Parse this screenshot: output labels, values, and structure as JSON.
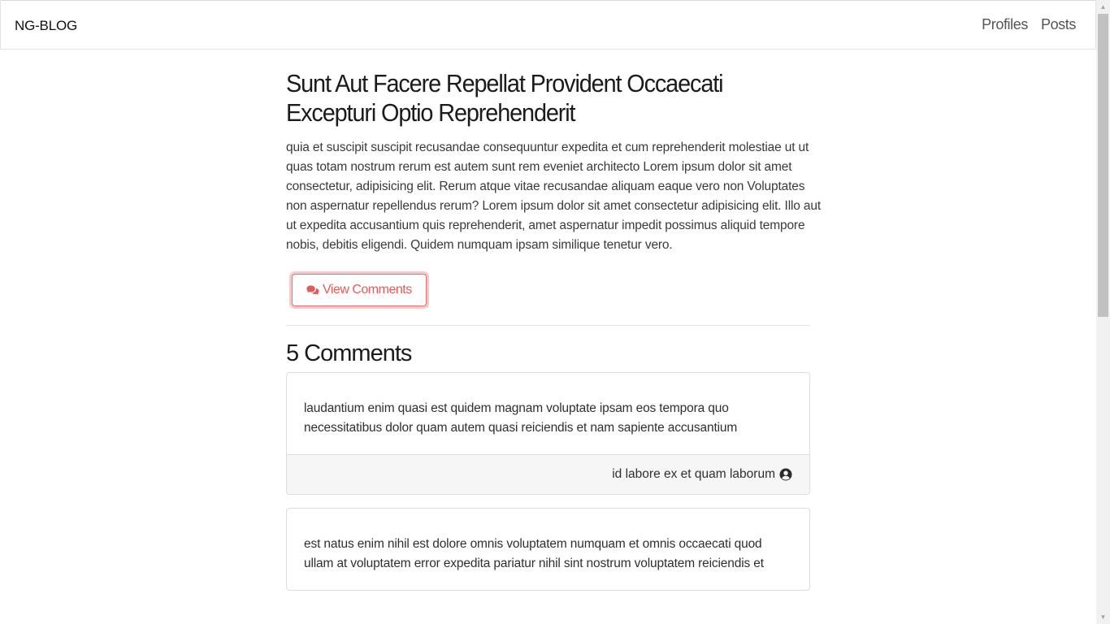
{
  "nav": {
    "brand": "NG-BLOG",
    "links": [
      "Profiles",
      "Posts"
    ]
  },
  "post": {
    "title": "Sunt Aut Facere Repellat Provident Occaecati Excepturi Optio Reprehenderit",
    "body": "quia et suscipit suscipit recusandae consequuntur expedita et cum reprehenderit molestiae ut ut quas totam nostrum rerum est autem sunt rem eveniet architecto Lorem ipsum dolor sit amet consectetur, adipisicing elit. Rerum atque vitae recusandae aliquam eaque vero non Voluptates non aspernatur repellendus rerum? Lorem ipsum dolor sit amet consectetur adipisicing elit. Illo aut ut expedita accusantium quis reprehenderit, amet aspernatur impedit possimus aliquid tempore nobis, debitis eligendi. Quidem numquam ipsam similique tenetur vero.",
    "view_comments_label": "View Comments"
  },
  "comments": {
    "heading": "5 Comments",
    "items": [
      {
        "body": "laudantium enim quasi est quidem magnam voluptate ipsam eos tempora quo necessitatibus dolor quam autem quasi reiciendis et nam sapiente accusantium",
        "author": "id labore ex et quam laborum"
      },
      {
        "body": "est natus enim nihil est dolore omnis voluptatem numquam et omnis occaecati quod ullam at voluptatem error expedita pariatur nihil sint nostrum voluptatem reiciendis et",
        "author": ""
      }
    ]
  },
  "icons": {
    "comments": "comments-icon",
    "user": "user-circle-icon"
  },
  "colors": {
    "accent": "#e25b5b",
    "accent_glow": "#f7c9c9",
    "footer_bg": "#f6f6f6"
  }
}
